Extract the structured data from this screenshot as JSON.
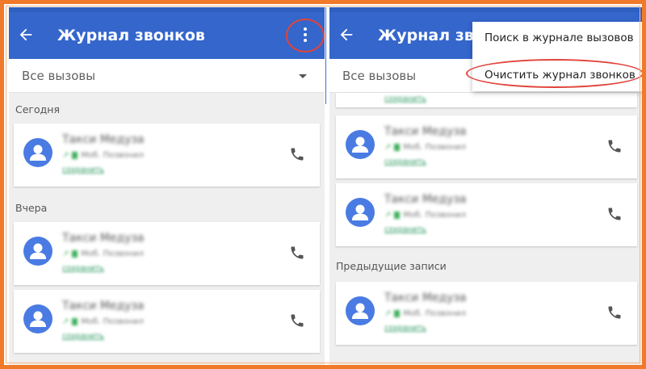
{
  "left_screen": {
    "title": "Журнал звонков",
    "filter_label": "Все вызовы",
    "sections": [
      {
        "label": "Сегодня",
        "calls": [
          {
            "name": "Такси Медуза",
            "meta": "Моб. Позвонил",
            "link": "сохранить"
          }
        ]
      },
      {
        "label": "Вчера",
        "calls": [
          {
            "name": "Такси Медуза",
            "meta": "Моб. Позвонил",
            "link": "сохранить"
          },
          {
            "name": "Такси Медуза",
            "meta": "Моб. Позвонил",
            "link": "сохранить"
          }
        ]
      }
    ]
  },
  "right_screen": {
    "title": "Журнал звон",
    "filter_label": "Все вызовы",
    "menu": {
      "items": [
        "Поиск в журнале вызовов",
        "Очистить журнал звонков"
      ]
    },
    "top_partial_link": "сохранить",
    "calls": [
      {
        "name": "Такси Медуза",
        "meta": "Моб. Позвонил",
        "link": "сохранить"
      },
      {
        "name": "Такси Медуза",
        "meta": "Моб. Позвонил",
        "link": "сохранить"
      }
    ],
    "section": {
      "label": "Предыдущие записи",
      "calls": [
        {
          "name": "Такси Медуза",
          "meta": "Моб. Позвонил",
          "link": "сохранить"
        }
      ]
    }
  },
  "colors": {
    "app_bar": "#3466cc",
    "accent_avatar": "#4a7be3",
    "highlight": "#e0443a",
    "frame": "#f07a2a"
  },
  "icons": {
    "back": "arrow-back-icon",
    "more": "more-vert-icon",
    "avatar": "person-icon",
    "call": "phone-icon",
    "dropdown": "caret-down-icon"
  }
}
